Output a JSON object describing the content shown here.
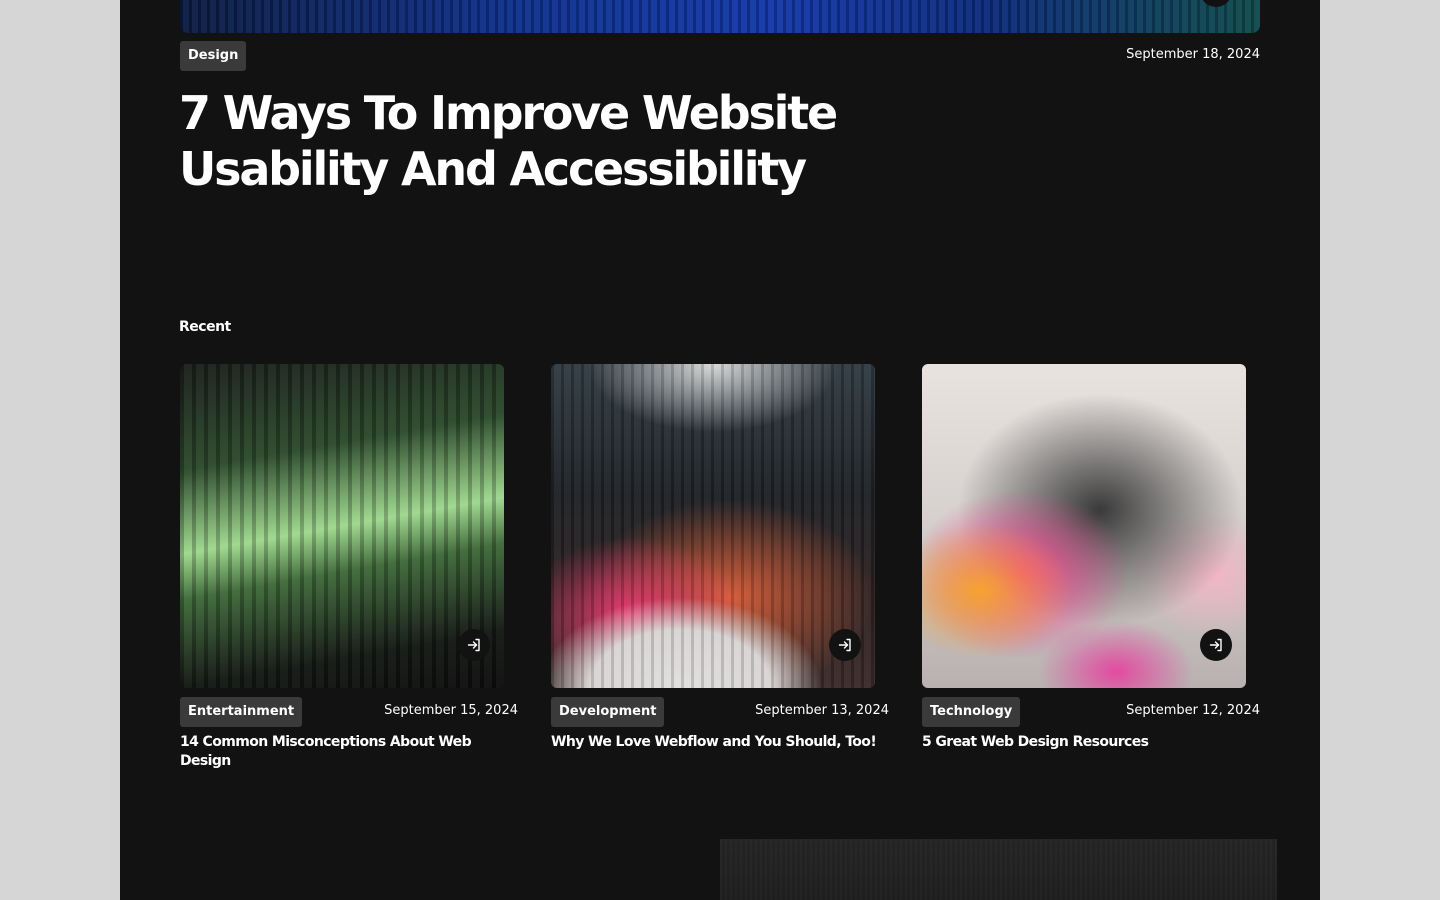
{
  "featured": {
    "tag": "Design",
    "date": "September 18, 2024",
    "title": "7 Ways To Improve Website Usability And Accessibility"
  },
  "recent": {
    "heading": "Recent",
    "posts": [
      {
        "tag": "Entertainment",
        "date": "September 15, 2024",
        "title": "14 Common Misconceptions About Web Design",
        "image": "green-light-streak"
      },
      {
        "tag": "Development",
        "date": "September 13, 2024",
        "title": "Why We Love Webflow and You Should, Too!",
        "image": "dark-red-blur"
      },
      {
        "tag": "Technology",
        "date": "September 12, 2024",
        "title": "5 Great Web Design Resources",
        "image": "pink-grey-blur"
      }
    ]
  },
  "icons": {
    "open_post": "enter-arrow-icon"
  },
  "colors": {
    "page_background": "#121212",
    "outer_background": "#d6d6d6",
    "tag_background": "#3a3a3a",
    "text": "#ffffff"
  }
}
